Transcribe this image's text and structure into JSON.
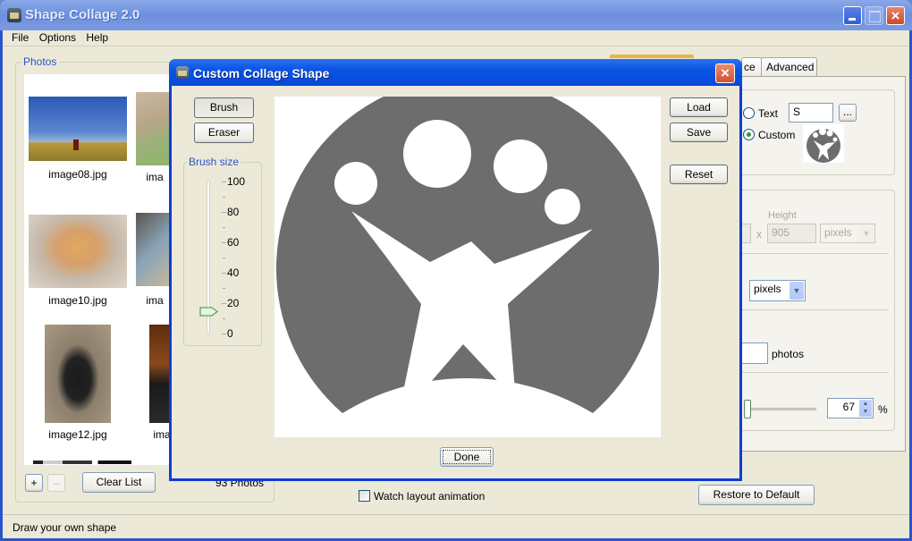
{
  "app": {
    "title": "Shape Collage 2.0",
    "window_controls": {
      "minimize": "minimize",
      "maximize": "maximize",
      "close": "×"
    }
  },
  "menu": [
    "File",
    "Options",
    "Help"
  ],
  "photos": {
    "group_label": "Photos",
    "items": [
      {
        "caption": "image08.jpg"
      },
      {
        "caption": "ima"
      },
      {
        "caption": "image10.jpg"
      },
      {
        "caption": "ima"
      },
      {
        "caption": "image12.jpg"
      },
      {
        "caption": "ima"
      }
    ],
    "add_label": "+",
    "remove_label": "–",
    "clear_label": "Clear List",
    "count_text": "93 Photos"
  },
  "settings": {
    "tabs": [
      {
        "label": "ce",
        "selected": false
      },
      {
        "label": "Advanced",
        "selected": false
      }
    ],
    "shape": {
      "text_option_label": "Text",
      "text_value": "S",
      "ellipsis_label": "...",
      "custom_option_label": "Custom",
      "selected": "Custom"
    },
    "size": {
      "height_label": "Height",
      "height_value": "905",
      "x_label": "x",
      "unit_value": "pixels"
    },
    "spacing_unit_value": "pixels",
    "photos_label": "photos",
    "photos_value": "",
    "percent_value": "67",
    "percent_label": "%",
    "watch_animation_label": "Watch layout animation",
    "watch_animation_checked": false,
    "restore_label": "Restore to Default"
  },
  "dialog": {
    "title": "Custom Collage Shape",
    "close_label": "×",
    "brush_label": "Brush",
    "eraser_label": "Eraser",
    "brush_size_label": "Brush size",
    "brush_size_ticks": [
      "100",
      "80",
      "60",
      "40",
      "20",
      "0"
    ],
    "brush_size_value": 15,
    "load_label": "Load",
    "save_label": "Save",
    "reset_label": "Reset",
    "done_label": "Done",
    "shape_color": "#6d6d6d"
  },
  "status": {
    "text": "Draw your own shape"
  }
}
